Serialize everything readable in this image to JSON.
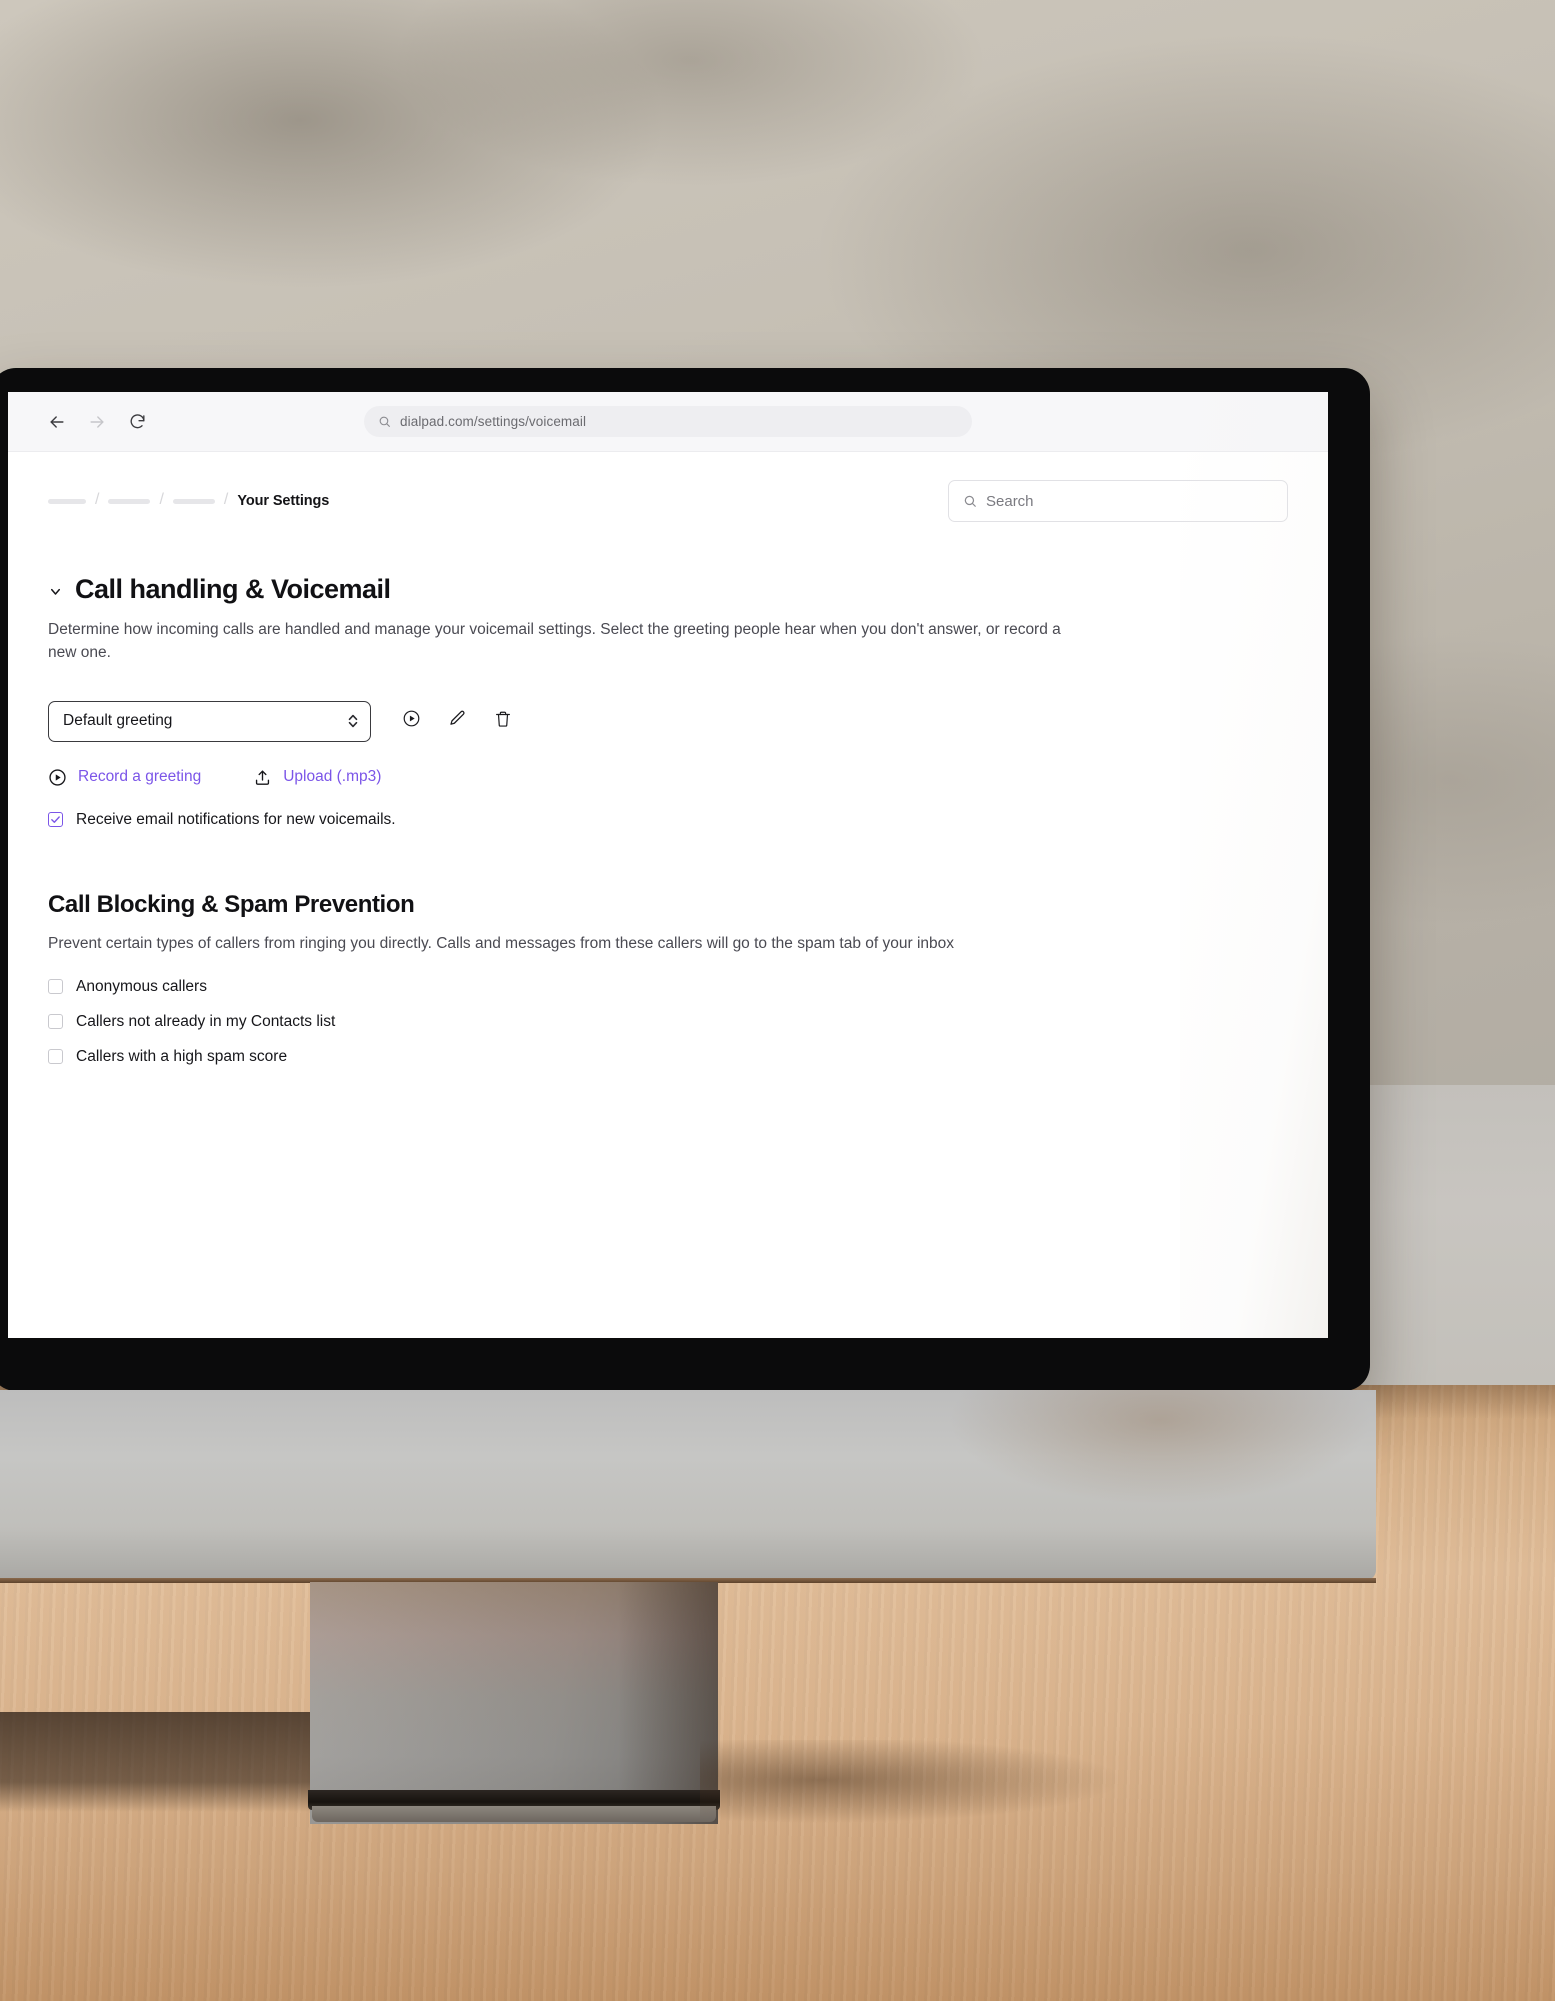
{
  "browser": {
    "back_icon": "arrow-left-icon",
    "forward_icon": "arrow-right-icon",
    "reload_icon": "reload-icon",
    "url": "dialpad.com/settings/voicemail",
    "url_icon": "search-icon"
  },
  "header": {
    "breadcrumb": {
      "redacted_count": 3,
      "separator": "/",
      "current": "Your Settings"
    },
    "search": {
      "icon": "search-icon",
      "placeholder": "Search",
      "value": ""
    }
  },
  "voicemail_section": {
    "collapse_icon": "chevron-down-icon",
    "title": "Call handling & Voicemail",
    "description": "Determine how incoming calls are handled and manage your voicemail settings. Select the greeting people hear when you don't answer, or record a new one.",
    "greeting_select": {
      "value": "Default greeting",
      "indicator_icon": "chevron-updown-icon",
      "options": [
        "Default greeting"
      ]
    },
    "greeting_actions": [
      {
        "name": "play-greeting",
        "icon": "play-circle-icon",
        "label": "Play"
      },
      {
        "name": "edit-greeting",
        "icon": "pencil-icon",
        "label": "Edit"
      },
      {
        "name": "delete-greeting",
        "icon": "trash-icon",
        "label": "Delete"
      }
    ],
    "links": [
      {
        "name": "record-a-greeting",
        "icon": "play-circle-icon",
        "label": "Record a greeting"
      },
      {
        "name": "upload-mp3",
        "icon": "upload-icon",
        "label": "Upload (.mp3)"
      }
    ],
    "email_notifications": {
      "label": "Receive email notifications for new voicemails.",
      "checked": true,
      "check_icon": "checkmark-icon"
    }
  },
  "blocking_section": {
    "title": "Call Blocking & Spam Prevention",
    "description": "Prevent certain types of callers from ringing you directly. Calls and messages from these callers will go to the spam tab of your inbox",
    "options": [
      {
        "label": "Anonymous callers",
        "checked": false
      },
      {
        "label": "Callers not already in my Contacts list",
        "checked": false
      },
      {
        "label": "Callers with a high spam score",
        "checked": false
      }
    ]
  },
  "colors": {
    "accent_purple": "#7b55e8",
    "text_primary": "#111114",
    "text_secondary": "#4a4a52",
    "border": "#e1e1e5",
    "bezel_black": "#0b0b0c"
  }
}
